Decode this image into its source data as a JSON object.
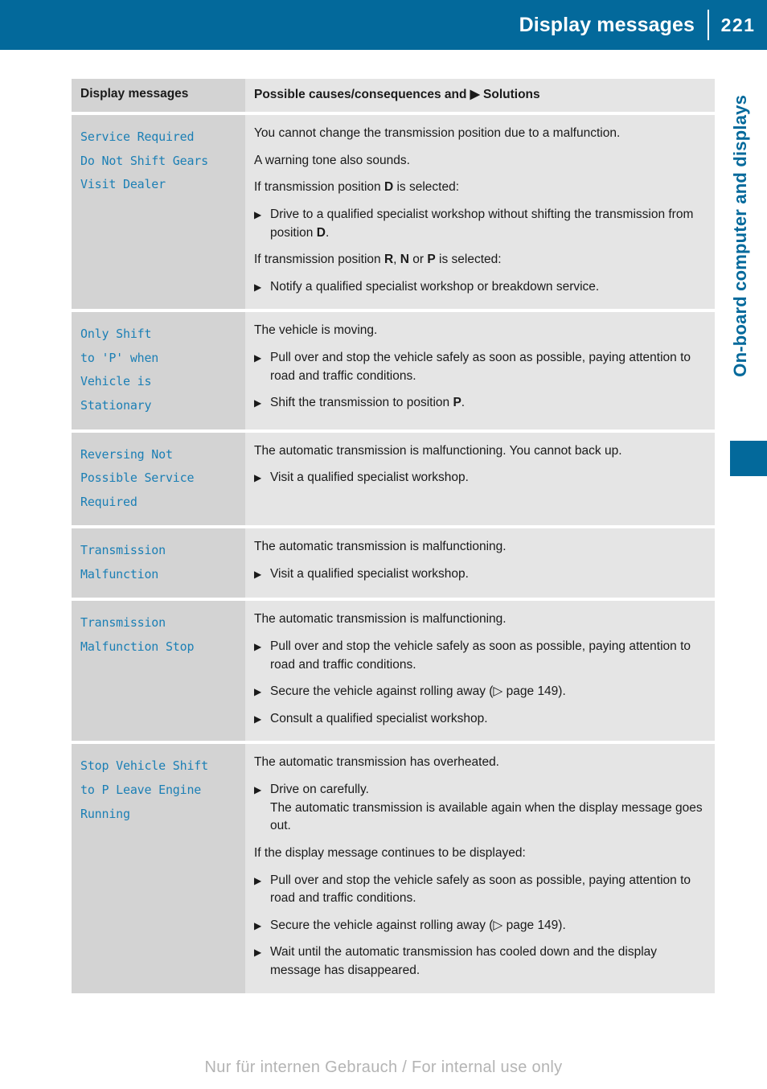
{
  "header": {
    "title": "Display messages",
    "page_number": "221"
  },
  "side_tab": {
    "chapter_label": "On-board computer and displays"
  },
  "table": {
    "columns": {
      "left_header": "Display messages",
      "right_header_prefix": "Possible causes/consequences and ",
      "right_header_bullet": "▶",
      "right_header_suffix": " Solutions"
    },
    "rows": [
      {
        "message": "Service Required\nDo Not Shift Gears\nVisit Dealer",
        "blocks": [
          {
            "kind": "para",
            "html": "You cannot change the transmission position due to a malfunction."
          },
          {
            "kind": "para",
            "html": "A warning tone also sounds."
          },
          {
            "kind": "para",
            "html": "If transmission position <b>D</b> is selected:"
          },
          {
            "kind": "bullet",
            "html": "Drive to a qualified specialist workshop without shifting the transmission from position <b>D</b>."
          },
          {
            "kind": "para",
            "html": "If transmission position <b>R</b>, <b>N</b> or <b>P</b> is selected:"
          },
          {
            "kind": "bullet",
            "html": "Notify a qualified specialist workshop or breakdown service."
          }
        ]
      },
      {
        "message": "Only Shift\nto 'P' when\nVehicle is\nStationary",
        "blocks": [
          {
            "kind": "para",
            "html": "The vehicle is moving."
          },
          {
            "kind": "bullet",
            "html": "Pull over and stop the vehicle safely as soon as possible, paying attention to road and traffic conditions."
          },
          {
            "kind": "bullet",
            "html": "Shift the transmission to position <b>P</b>."
          }
        ]
      },
      {
        "message": "Reversing Not\nPossible Service\nRequired",
        "blocks": [
          {
            "kind": "para",
            "html": "The automatic transmission is malfunctioning. You cannot back up."
          },
          {
            "kind": "bullet",
            "html": "Visit a qualified specialist workshop."
          }
        ]
      },
      {
        "message": "Transmission\nMalfunction",
        "blocks": [
          {
            "kind": "para",
            "html": "The automatic transmission is malfunctioning."
          },
          {
            "kind": "bullet",
            "html": "Visit a qualified specialist workshop."
          }
        ]
      },
      {
        "message": "Transmission\nMalfunction Stop",
        "blocks": [
          {
            "kind": "para",
            "html": "The automatic transmission is malfunctioning."
          },
          {
            "kind": "bullet",
            "html": "Pull over and stop the vehicle safely as soon as possible, paying attention to road and traffic conditions."
          },
          {
            "kind": "bullet",
            "html": "Secure the vehicle against rolling away (▷ page 149)."
          },
          {
            "kind": "bullet",
            "html": "Consult a qualified specialist workshop."
          }
        ]
      },
      {
        "message": "Stop Vehicle Shift\nto P Leave Engine\nRunning",
        "blocks": [
          {
            "kind": "para",
            "html": "The automatic transmission has overheated."
          },
          {
            "kind": "bullet",
            "html": "Drive on carefully.<br>The automatic transmission is available again when the display message goes out."
          },
          {
            "kind": "para",
            "html": "If the display message continues to be displayed:"
          },
          {
            "kind": "bullet",
            "html": "Pull over and stop the vehicle safely as soon as possible, paying attention to road and traffic conditions."
          },
          {
            "kind": "bullet",
            "html": "Secure the vehicle against rolling away (▷ page 149)."
          },
          {
            "kind": "bullet",
            "html": "Wait until the automatic transmission has cooled down and the display message has disappeared."
          }
        ]
      }
    ]
  },
  "footer": {
    "watermark": "Nur für internen Gebrauch / For internal use only"
  },
  "colors": {
    "brand_blue": "#03699B",
    "message_blue": "#1B7FB5",
    "cell_left_bg": "#d3d3d3",
    "cell_right_bg": "#e5e5e5"
  },
  "icons": {
    "solid_triangle": "▶",
    "hollow_triangle": "▷"
  }
}
